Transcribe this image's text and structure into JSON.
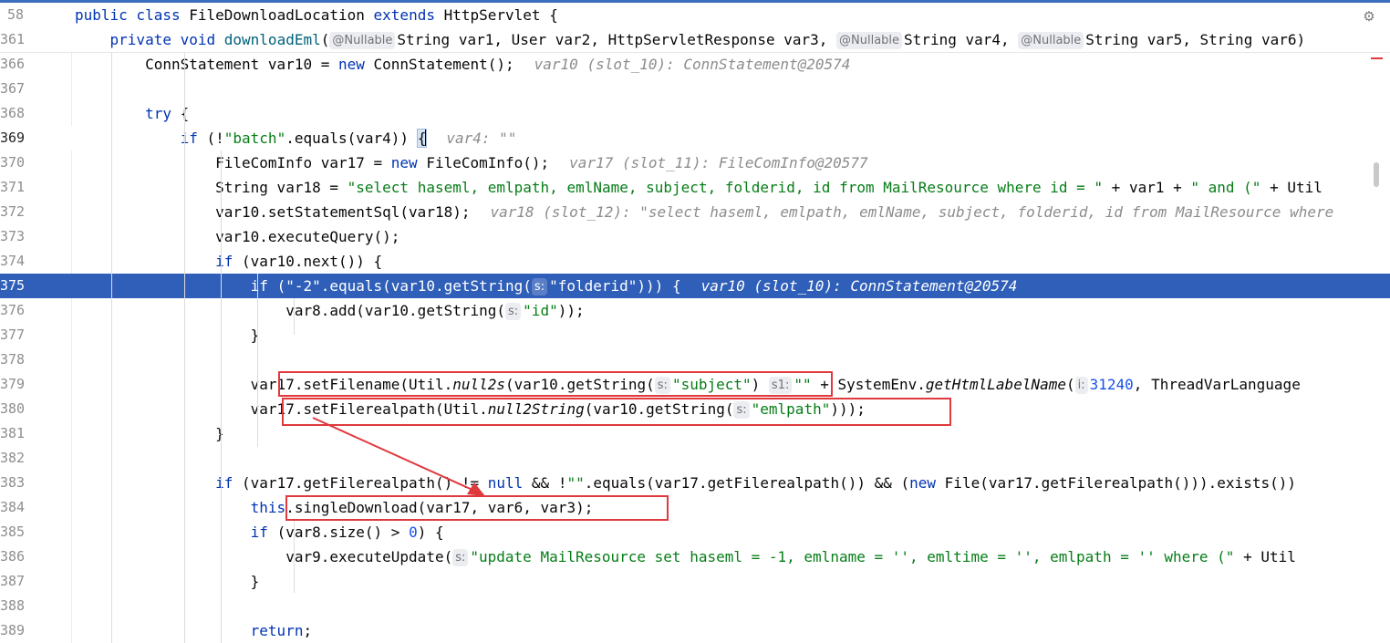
{
  "editor": {
    "settings_icon": "gear-icon",
    "scrollbar_thumb": "scrollbar-thumb"
  },
  "lines": [
    {
      "n": "58",
      "parts": [
        [
          "kw",
          "public class "
        ],
        [
          "",
          "FileDownloadLocation "
        ],
        [
          "kw",
          "extends "
        ],
        [
          "",
          "HttpServlet {"
        ]
      ]
    },
    {
      "n": "361",
      "parts": [
        [
          "kw",
          "    private void "
        ],
        [
          "method",
          "downloadEml"
        ],
        [
          "",
          "("
        ],
        [
          "inlay",
          "@Nullable"
        ],
        [
          "",
          "String var1, User var2, HttpServletResponse var3, "
        ],
        [
          "inlay",
          "@Nullable"
        ],
        [
          "",
          "String var4, "
        ],
        [
          "inlay",
          "@Nullable"
        ],
        [
          "",
          "String var5, String var6)"
        ]
      ]
    },
    {
      "n": "366",
      "parts": [
        [
          "",
          "        ConnStatement var10 = "
        ],
        [
          "kw",
          "new "
        ],
        [
          "",
          "ConnStatement();"
        ],
        [
          "hint",
          "var10 (slot_10): ConnStatement@20574"
        ]
      ]
    },
    {
      "n": "367",
      "parts": []
    },
    {
      "n": "368",
      "parts": [
        [
          "kw",
          "        try "
        ],
        [
          "",
          "{"
        ]
      ]
    },
    {
      "n": "369",
      "parts": [
        [
          "kw",
          "            if "
        ],
        [
          "",
          "(!"
        ],
        [
          "str",
          "\"batch\""
        ],
        [
          "",
          ".equals(var4)) "
        ],
        [
          "brace",
          "{"
        ],
        [
          "hint",
          "var4: \"\""
        ]
      ]
    },
    {
      "n": "370",
      "parts": [
        [
          "",
          "                FileComInfo var17 = "
        ],
        [
          "kw",
          "new "
        ],
        [
          "",
          "FileComInfo();"
        ],
        [
          "hint",
          "var17 (slot_11): FileComInfo@20577"
        ]
      ]
    },
    {
      "n": "371",
      "parts": [
        [
          "",
          "                String var18 = "
        ],
        [
          "str",
          "\"select haseml, emlpath, emlName, subject, folderid, id from MailResource where id = \""
        ],
        [
          "",
          " + var1 + "
        ],
        [
          "str",
          "\" and (\""
        ],
        [
          "",
          " + Util"
        ]
      ]
    },
    {
      "n": "372",
      "parts": [
        [
          "",
          "                var10.setStatementSql(var18);"
        ],
        [
          "hint",
          "var18 (slot_12): \"select haseml, emlpath, emlName, subject, folderid, id from MailResource where"
        ]
      ]
    },
    {
      "n": "373",
      "parts": [
        [
          "",
          "                var10.executeQuery();"
        ]
      ]
    },
    {
      "n": "374",
      "parts": [
        [
          "kw",
          "                if "
        ],
        [
          "",
          "(var10.next()) {"
        ]
      ]
    },
    {
      "n": "375",
      "parts": [
        [
          "kw",
          "                    if "
        ],
        [
          "",
          "("
        ],
        [
          "str",
          "\"-2\""
        ],
        [
          "",
          ".equals(var10.getString("
        ],
        [
          "inlay",
          "s:"
        ],
        [
          "str",
          "\"folderid\""
        ],
        [
          "",
          ")))"
        ],
        [
          "",
          " {"
        ],
        [
          "hint",
          "var10 (slot_10): ConnStatement@20574"
        ]
      ]
    },
    {
      "n": "376",
      "parts": [
        [
          "",
          "                        var8.add(var10.getString("
        ],
        [
          "inlay",
          "s:"
        ],
        [
          "str",
          "\"id\""
        ],
        [
          "",
          "));"
        ]
      ]
    },
    {
      "n": "377",
      "parts": [
        [
          "",
          "                    }"
        ]
      ]
    },
    {
      "n": "378",
      "parts": []
    },
    {
      "n": "379",
      "parts": [
        [
          "",
          "                    var17.setFilename(Util."
        ],
        [
          "ital",
          "null2s"
        ],
        [
          "",
          "(var10.getString("
        ],
        [
          "inlay",
          "s:"
        ],
        [
          "str",
          "\"subject\""
        ],
        [
          "",
          ")"
        ],
        [
          "",
          " "
        ],
        [
          "inlay",
          "s1:"
        ],
        [
          "str",
          "\"\""
        ],
        [
          "",
          " + SystemEnv."
        ],
        [
          "ital",
          "getHtmlLabelName"
        ],
        [
          "",
          "("
        ],
        [
          "inlay",
          "i:"
        ],
        [
          "num",
          "31240"
        ],
        [
          "",
          ", ThreadVarLanguage"
        ]
      ]
    },
    {
      "n": "380",
      "parts": [
        [
          "",
          "                    var17.setFilerealpath(Util."
        ],
        [
          "ital",
          "null2String"
        ],
        [
          "",
          "(var10.getString("
        ],
        [
          "inlay",
          "s:"
        ],
        [
          "str",
          "\"emlpath\""
        ],
        [
          "",
          ")));"
        ]
      ]
    },
    {
      "n": "381",
      "parts": [
        [
          "",
          "                }"
        ]
      ]
    },
    {
      "n": "382",
      "parts": []
    },
    {
      "n": "383",
      "parts": [
        [
          "kw",
          "                if "
        ],
        [
          "",
          "(var17.getFilerealpath() != "
        ],
        [
          "kw",
          "null "
        ],
        [
          "",
          "&& !"
        ],
        [
          "str",
          "\"\""
        ],
        [
          "",
          ".equals(var17.getFilerealpath()) && ("
        ],
        [
          "kw",
          "new "
        ],
        [
          "",
          "File(var17.getFilerealpath())).exists())"
        ]
      ]
    },
    {
      "n": "384",
      "parts": [
        [
          "kw",
          "                    this"
        ],
        [
          "",
          ".singleDownload(var17, var6, var3);"
        ]
      ]
    },
    {
      "n": "385",
      "parts": [
        [
          "kw",
          "                    if "
        ],
        [
          "",
          "(var8.size() > "
        ],
        [
          "num",
          "0"
        ],
        [
          "",
          ") {"
        ]
      ]
    },
    {
      "n": "386",
      "parts": [
        [
          "",
          "                        var9.executeUpdate("
        ],
        [
          "inlay",
          "s:"
        ],
        [
          "str",
          "\"update MailResource set haseml = -1, emlname = '', emltime = '', emlpath = '' where (\""
        ],
        [
          "",
          " + Util"
        ]
      ]
    },
    {
      "n": "387",
      "parts": [
        [
          "",
          "                    }"
        ]
      ]
    },
    {
      "n": "388",
      "parts": []
    },
    {
      "n": "389",
      "parts": [
        [
          "kw",
          "                    return"
        ],
        [
          "",
          ";"
        ]
      ]
    }
  ]
}
